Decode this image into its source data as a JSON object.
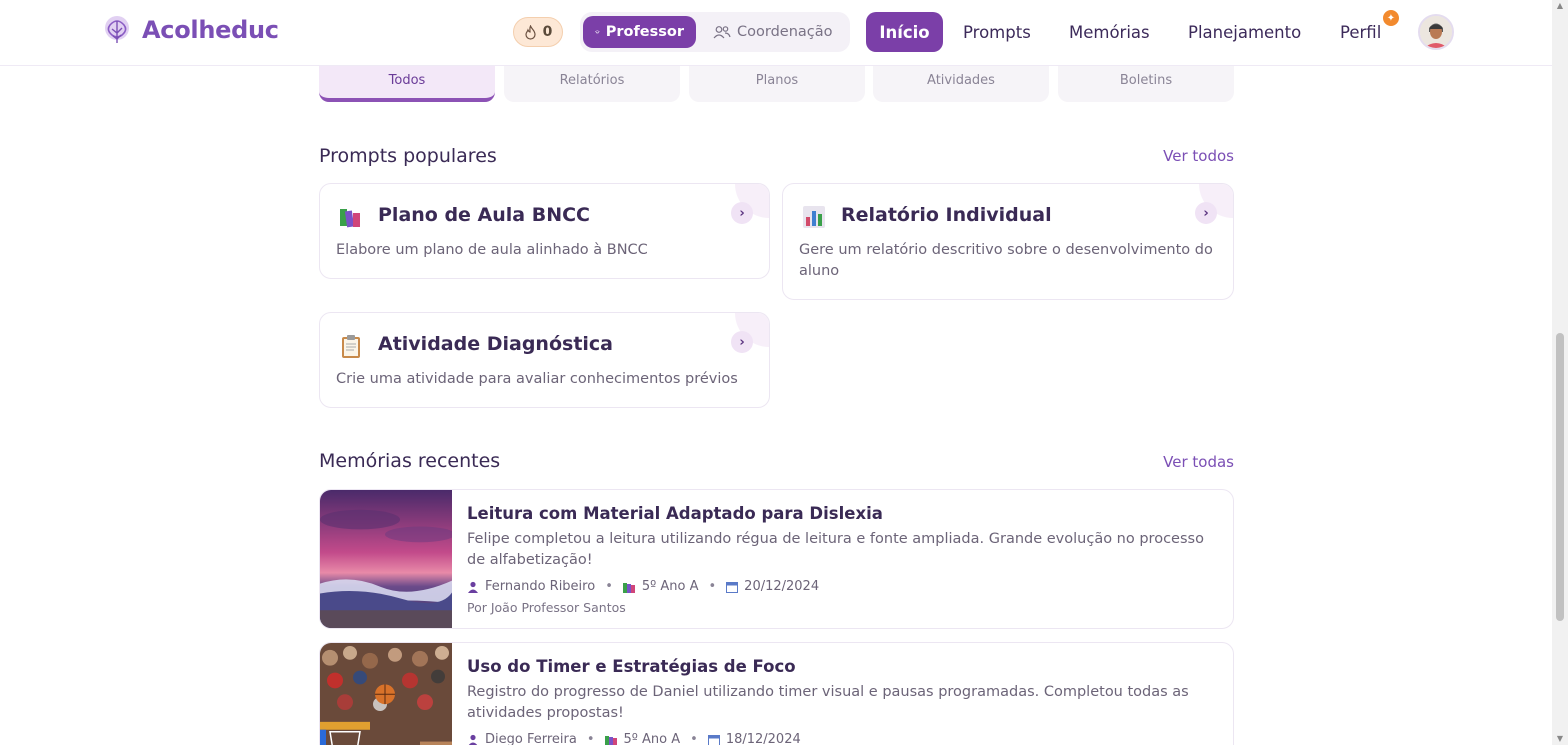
{
  "app": {
    "name": "Acolheduc"
  },
  "header": {
    "streak_count": "0",
    "roles": [
      {
        "label": "Professor",
        "active": true
      },
      {
        "label": "Coordenação",
        "active": false
      }
    ],
    "nav": [
      {
        "label": "Início",
        "active": true
      },
      {
        "label": "Prompts",
        "active": false
      },
      {
        "label": "Memórias",
        "active": false
      },
      {
        "label": "Planejamento",
        "active": false
      },
      {
        "label": "Perfil",
        "active": false
      }
    ],
    "notification_icon": "sparkle-icon"
  },
  "category_tabs": [
    {
      "label": "Todos",
      "active": true
    },
    {
      "label": "Relatórios",
      "active": false
    },
    {
      "label": "Planos",
      "active": false
    },
    {
      "label": "Atividades",
      "active": false
    },
    {
      "label": "Boletins",
      "active": false
    }
  ],
  "prompts_section": {
    "title": "Prompts populares",
    "see_all": "Ver todos",
    "cards": [
      {
        "icon": "books-icon",
        "title": "Plano de Aula BNCC",
        "description": "Elabore um plano de aula alinhado à BNCC"
      },
      {
        "icon": "bar-chart-icon",
        "title": "Relatório Individual",
        "description": "Gere um relatório descritivo sobre o desenvolvimento do aluno"
      },
      {
        "icon": "clipboard-icon",
        "title": "Atividade Diagnóstica",
        "description": "Crie uma atividade para avaliar conhecimentos prévios"
      }
    ]
  },
  "memories_section": {
    "title": "Memórias recentes",
    "see_all": "Ver todas",
    "items": [
      {
        "title": "Leitura com Material Adaptado para Dislexia",
        "description": "Felipe completou a leitura utilizando régua de leitura e fonte ampliada. Grande evolução no processo de alfabetização!",
        "student": "Fernando Ribeiro",
        "class": "5º Ano A",
        "date": "20/12/2024",
        "author": "Por João Professor Santos",
        "image": "sunset-beach-image"
      },
      {
        "title": "Uso do Timer e Estratégias de Foco",
        "description": "Registro do progresso de Daniel utilizando timer visual e pausas programadas. Completou todas as atividades propostas!",
        "student": "Diego Ferreira",
        "class": "5º Ano A",
        "date": "18/12/2024",
        "author": "",
        "image": "basketball-image"
      }
    ]
  },
  "colors": {
    "brand": "#7b3fa8",
    "accent_light": "#f3e8f8",
    "streak_bg": "#fde8d6"
  }
}
